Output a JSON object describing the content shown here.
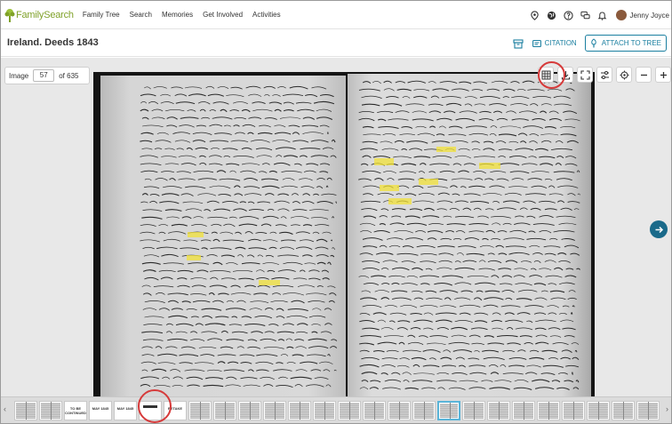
{
  "nav": {
    "logo": "FamilySearch",
    "links": [
      "Family Tree",
      "Search",
      "Memories",
      "Get Involved",
      "Activities"
    ],
    "user_name": "Jenny Joyce"
  },
  "record": {
    "title": "Ireland. Deeds 1843",
    "citation_label": "CITATION",
    "attach_label": "ATTACH TO TREE"
  },
  "viewer": {
    "image_label": "Image",
    "image_number": "57",
    "of_label": "of 635",
    "highlight_color": "#f2e238"
  },
  "filmstrip": {
    "thumb_labels": [
      "TO BE CONTINUED",
      "MAY 1845",
      "MAY 1845",
      "RETAKE"
    ]
  }
}
